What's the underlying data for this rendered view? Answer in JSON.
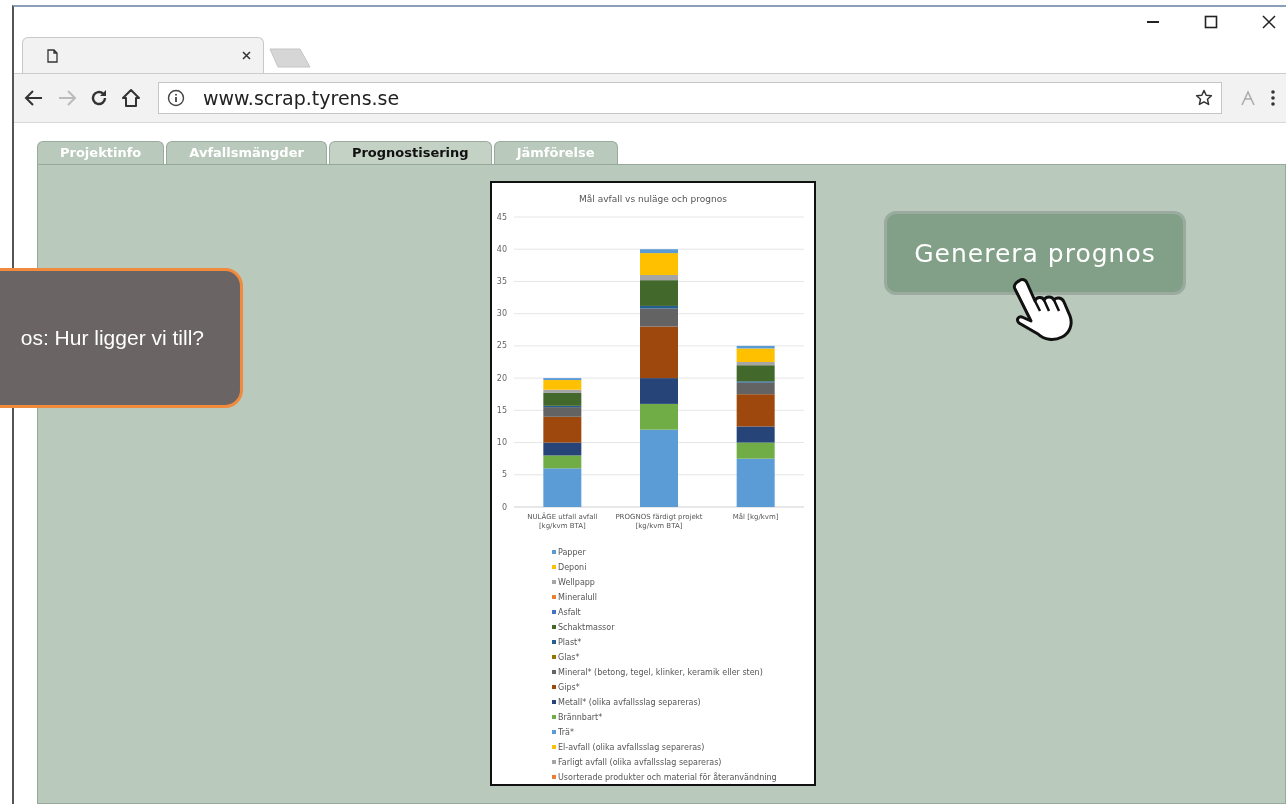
{
  "browser": {
    "url": "www.scrap.tyrens.se"
  },
  "tabs": [
    {
      "label": "Projektinfo",
      "selected": false
    },
    {
      "label": "Avfallsmängder",
      "selected": false
    },
    {
      "label": "Prognostisering",
      "selected": true
    },
    {
      "label": "Jämförelse",
      "selected": false
    }
  ],
  "callout": {
    "text": "os: Hur ligger vi till?"
  },
  "generate_button": {
    "label": "Generera prognos"
  },
  "chart_data": {
    "type": "bar",
    "stacked": true,
    "title": "Mål avfall vs nuläge och prognos",
    "categories": [
      "NULÄGE utfall avfall [kg/kvm BTA]",
      "PROGNOS färdigt projekt [kg/kvm BTA]",
      "Mål [kg/kvm]"
    ],
    "ylim": [
      0,
      45
    ],
    "grid": true,
    "yticks": [
      0,
      5,
      10,
      15,
      20,
      25,
      30,
      35,
      40,
      45
    ],
    "series": [
      {
        "name": "Usorterade produkter och material för återanvändning",
        "color": "#ed7d32",
        "values": [
          0,
          0,
          0
        ]
      },
      {
        "name": "Farligt avfall (olika avfallsslag separeras)",
        "color": "#a5a5a6",
        "values": [
          0,
          0,
          0
        ]
      },
      {
        "name": "El-avfall (olika avfallsslag separeras)",
        "color": "#ffc001",
        "values": [
          0,
          0,
          0
        ]
      },
      {
        "name": "Trä*",
        "color": "#5b9bd6",
        "values": [
          6,
          12,
          7.5
        ]
      },
      {
        "name": "Brännbart*",
        "color": "#70ad47",
        "values": [
          2,
          4,
          2.5
        ]
      },
      {
        "name": "Metall* (olika avfallsslag separeras)",
        "color": "#264478",
        "values": [
          2,
          4,
          2.5
        ]
      },
      {
        "name": "Gips*",
        "color": "#9e480e",
        "values": [
          4,
          8,
          5
        ]
      },
      {
        "name": "Mineral* (betong, tegel, klinker, keramik eller sten)",
        "color": "#636363",
        "values": [
          1.5,
          2.8,
          1.8
        ]
      },
      {
        "name": "Glas*",
        "color": "#997300",
        "values": [
          0,
          0,
          0
        ]
      },
      {
        "name": "Plast*",
        "color": "#255e91",
        "values": [
          0.2,
          0.4,
          0.2
        ]
      },
      {
        "name": "Schaktmassor",
        "color": "#43682b",
        "values": [
          2,
          4,
          2.5
        ]
      },
      {
        "name": "Asfalt",
        "color": "#4472c4",
        "values": [
          0,
          0,
          0
        ]
      },
      {
        "name": "Mineralull",
        "color": "#ed7d31",
        "values": [
          0,
          0,
          0
        ]
      },
      {
        "name": "Wellpapp",
        "color": "#a5a5a5",
        "values": [
          0.5,
          0.8,
          0.5
        ]
      },
      {
        "name": "Deponi",
        "color": "#ffc000",
        "values": [
          1.5,
          3.4,
          2.1
        ]
      },
      {
        "name": "Papper",
        "color": "#5b9bd5",
        "values": [
          0.3,
          0.6,
          0.4
        ]
      }
    ]
  }
}
